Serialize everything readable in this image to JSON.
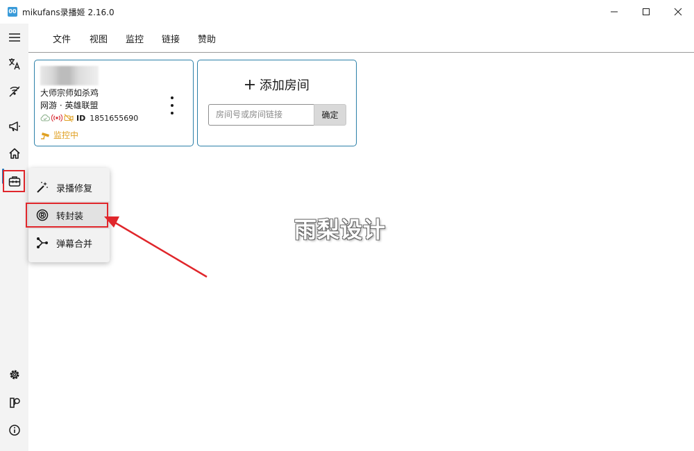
{
  "window": {
    "title": "mikufans录播姬 2.16.0",
    "icon_text": "00"
  },
  "menubar": {
    "items": [
      "文件",
      "视图",
      "监控",
      "链接",
      "赞助"
    ]
  },
  "room_card": {
    "streamer": "大师宗师如杀鸡",
    "category": "网游 · 英雄联盟",
    "id_label": "ID",
    "room_id": "1851655690",
    "status": "监控中"
  },
  "add_room": {
    "title": "添加房间",
    "input_placeholder": "房间号或房间链接",
    "confirm_label": "确定"
  },
  "tools_menu": {
    "items": [
      {
        "label": "录播修复",
        "icon": "magic-wand-icon"
      },
      {
        "label": "转封装",
        "icon": "remux-icon"
      },
      {
        "label": "弹幕合并",
        "icon": "merge-icon"
      }
    ]
  },
  "watermark": "雨梨设计",
  "colors": {
    "accent": "#1a73b8",
    "card_border": "#2a7fa8",
    "monitoring": "#e0a020",
    "highlight": "#e0262b"
  }
}
